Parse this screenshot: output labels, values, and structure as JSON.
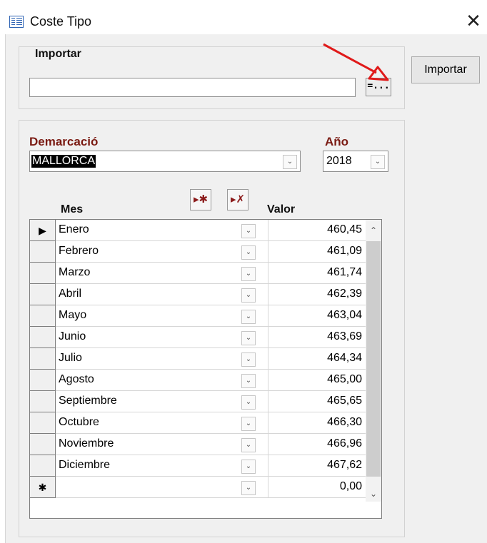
{
  "window": {
    "title": "Coste Tipo",
    "close_symbol": "✕",
    "icon": "form-icon"
  },
  "import": {
    "group_label": "Importar",
    "path_value": "",
    "browse_label": "=...",
    "import_button": "Importar"
  },
  "filters": {
    "demarcacion_label": "Demarcació",
    "demarcacion_value": "MALLORCA",
    "anio_label": "Año",
    "anio_value": "2018"
  },
  "toolbar": {
    "new_record_icon": "new-record-icon",
    "delete_record_icon": "delete-record-icon"
  },
  "grid": {
    "columns": [
      "Mes",
      "Valor"
    ],
    "rows": [
      {
        "mes": "Enero",
        "valor": "460,45"
      },
      {
        "mes": "Febrero",
        "valor": "461,09"
      },
      {
        "mes": "Marzo",
        "valor": "461,74"
      },
      {
        "mes": "Abril",
        "valor": "462,39"
      },
      {
        "mes": "Mayo",
        "valor": "463,04"
      },
      {
        "mes": "Junio",
        "valor": "463,69"
      },
      {
        "mes": "Julio",
        "valor": "464,34"
      },
      {
        "mes": "Agosto",
        "valor": "465,00"
      },
      {
        "mes": "Septiembre",
        "valor": "465,65"
      },
      {
        "mes": "Octubre",
        "valor": "466,30"
      },
      {
        "mes": "Noviembre",
        "valor": "466,96"
      },
      {
        "mes": "Diciembre",
        "valor": "467,62"
      }
    ],
    "new_row": {
      "mes": "",
      "valor": "0,00"
    },
    "current_row_marker": "▶",
    "new_row_marker": "✱"
  },
  "colors": {
    "label_red": "#7a1a12",
    "annotation_arrow": "#e01a1a",
    "background": "#f0f0f0"
  }
}
